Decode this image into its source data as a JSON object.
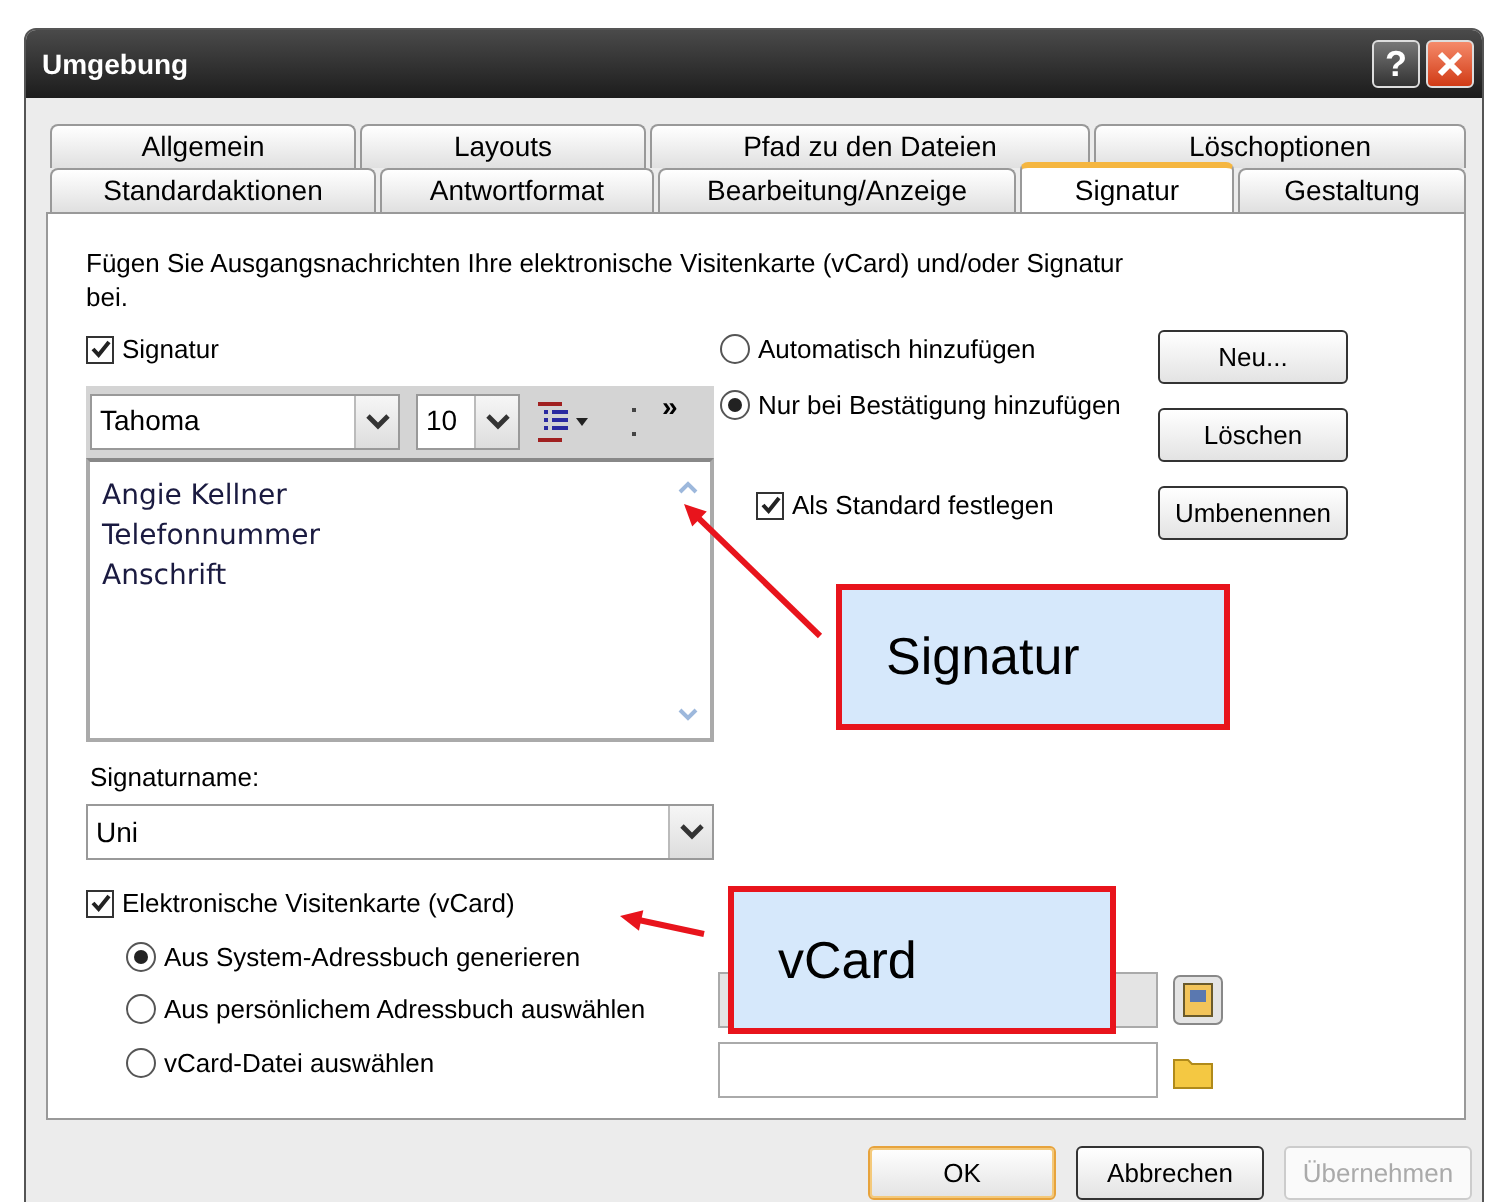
{
  "window": {
    "title": "Umgebung",
    "help": "?"
  },
  "tab_rows": [
    [
      {
        "label": "Allgemein",
        "selected": false
      },
      {
        "label": "Layouts",
        "selected": false
      },
      {
        "label": "Pfad zu den Dateien",
        "selected": false
      },
      {
        "label": "Löschoptionen",
        "selected": false
      }
    ],
    [
      {
        "label": "Standardaktionen",
        "selected": false
      },
      {
        "label": "Antwortformat",
        "selected": false
      },
      {
        "label": "Bearbeitung/Anzeige",
        "selected": false
      },
      {
        "label": "Signatur",
        "selected": true
      },
      {
        "label": "Gestaltung",
        "selected": false
      }
    ]
  ],
  "intro": "Fügen Sie Ausgangsnachrichten Ihre elektronische Visitenkarte (vCard) und/oder Signatur bei.",
  "signature": {
    "label": "Signatur",
    "checked": true,
    "font": "Tahoma",
    "size": "10",
    "more": "»",
    "lines": [
      "Angie Kellner",
      "Telefonnummer",
      "Anschrift"
    ]
  },
  "insert_options": [
    {
      "label": "Automatisch hinzufügen",
      "selected": false
    },
    {
      "label": "Nur bei Bestätigung hinzufügen",
      "selected": true
    }
  ],
  "default_checkbox": {
    "label": "Als Standard festlegen",
    "checked": true
  },
  "side_buttons": [
    "Neu...",
    "Löschen",
    "Umbenennen"
  ],
  "signature_name": {
    "label": "Signaturname:",
    "value": "Uni"
  },
  "vcard": {
    "label": "Elektronische Visitenkarte (vCard)",
    "checked": true,
    "options": [
      {
        "label": "Aus System-Adressbuch generieren",
        "selected": true
      },
      {
        "label": "Aus persönlichem Adressbuch auswählen",
        "selected": false
      },
      {
        "label": "vCard-Datei auswählen",
        "selected": false
      }
    ],
    "fields": [
      {
        "disabled": true
      },
      {
        "disabled": false
      }
    ]
  },
  "buttons": [
    {
      "label": "OK",
      "kind": "default",
      "disabled": false
    },
    {
      "label": "Abbrechen",
      "kind": "normal",
      "disabled": false
    },
    {
      "label": "Übernehmen",
      "kind": "normal",
      "disabled": true
    }
  ],
  "annotations": [
    {
      "text": "Signatur"
    },
    {
      "text": "vCard"
    }
  ]
}
